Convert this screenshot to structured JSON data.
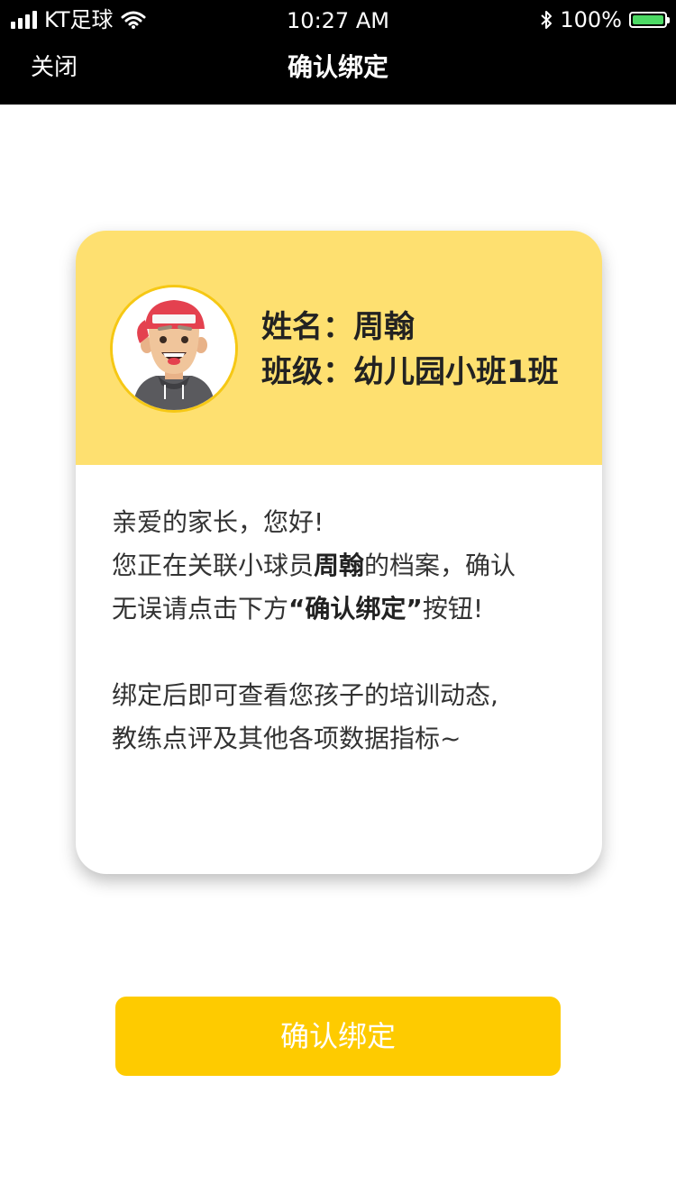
{
  "status_bar": {
    "carrier": "KT足球",
    "time": "10:27 AM",
    "battery": "100%",
    "battery_level": 1.0,
    "battery_color": "#4cd964"
  },
  "nav": {
    "close_label": "关闭",
    "title": "确认绑定"
  },
  "card": {
    "header_color": "#fee070",
    "name_label": "姓名：",
    "name_value": "周翰",
    "class_label": "班级：",
    "class_value": "幼儿园小班1班",
    "greeting": "亲爱的家长，您好!",
    "line1_pre": "您正在关联小球员",
    "line1_name": "周翰",
    "line1_post": "的档案，确认",
    "line2_pre": "无误请点击下方",
    "line2_bold": "“确认绑定”",
    "line2_post": "按钮!",
    "para2_line1": "绑定后即可查看您孩子的培训动态,",
    "para2_line2": "教练点评及其他各项数据指标~"
  },
  "button": {
    "label": "确认绑定",
    "color": "#fecb00"
  }
}
